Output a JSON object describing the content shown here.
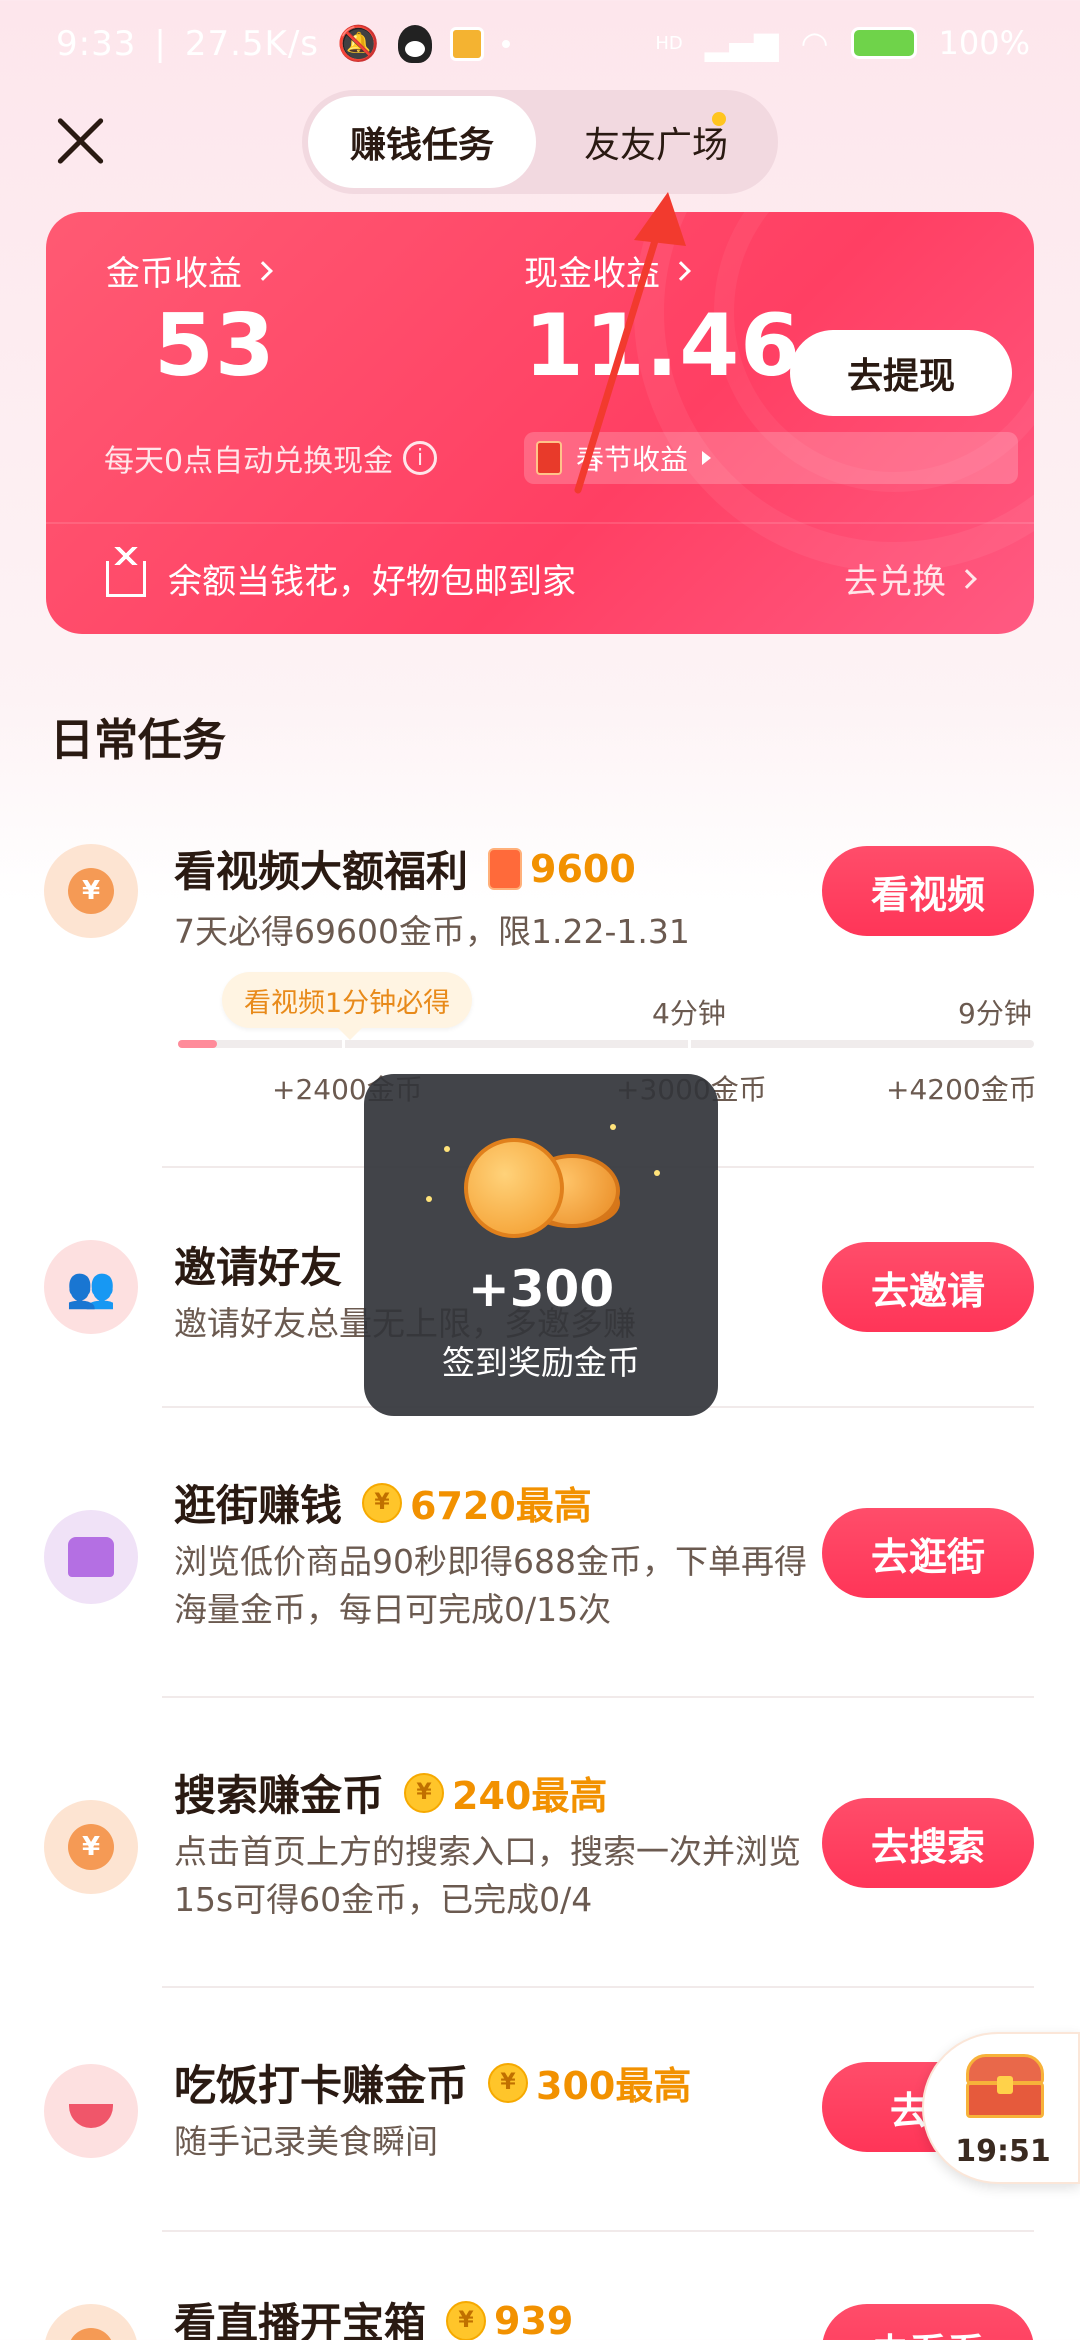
{
  "status": {
    "time": "9:33",
    "speed": "27.5K/s",
    "battery": "100%",
    "hd": "HD"
  },
  "tabs": {
    "earn": "赚钱任务",
    "friends": "友友广场"
  },
  "wallet": {
    "coin_label": "金币收益",
    "coin_value": "53",
    "coin_note": "每天0点自动兑换现金",
    "cash_label": "现金收益",
    "cash_value": "11.46",
    "withdraw_label": "去提现",
    "spring_label": "春节收益",
    "promo_text": "余额当钱花，好物包邮到家",
    "exchange_label": "去兑换"
  },
  "section_title": "日常任务",
  "tasks": [
    {
      "title": "看视频大额福利",
      "reward": "9600",
      "desc": "7天必得69600金币，限1.22-1.31",
      "button": "看视频"
    },
    {
      "title": "邀请好友",
      "desc": "邀请好友总量无上限，多邀多赚",
      "button": "去邀请"
    },
    {
      "title": "逛街赚钱",
      "reward": "6720最高",
      "desc": "浏览低价商品90秒即得688金币，下单再得海量金币，每日可完成0/15次",
      "button": "去逛街"
    },
    {
      "title": "搜索赚金币",
      "reward": "240最高",
      "desc": "点击首页上方的搜索入口，搜索一次并浏览15s可得60金币，已完成0/4",
      "button": "去搜索"
    },
    {
      "title": "吃饭打卡赚金币",
      "reward": "300最高",
      "desc": "随手记录美食瞬间",
      "button": "去签"
    },
    {
      "title": "看直播开宝箱",
      "reward": "939",
      "button": "去看看"
    }
  ],
  "video_progress": {
    "tooltip": "看视频1分钟必得",
    "fill_fraction": 0.045,
    "milestones": [
      {
        "time": "",
        "coins": "+2400金币"
      },
      {
        "time": "4分钟",
        "coins": "+3000金币"
      },
      {
        "time": "9分钟",
        "coins": "+4200金币"
      }
    ]
  },
  "toast": {
    "amount": "+300",
    "caption": "签到奖励金币"
  },
  "float_box": {
    "time": "19:51"
  },
  "colors": {
    "accent": "#ff3f63",
    "coin": "#f29100"
  }
}
